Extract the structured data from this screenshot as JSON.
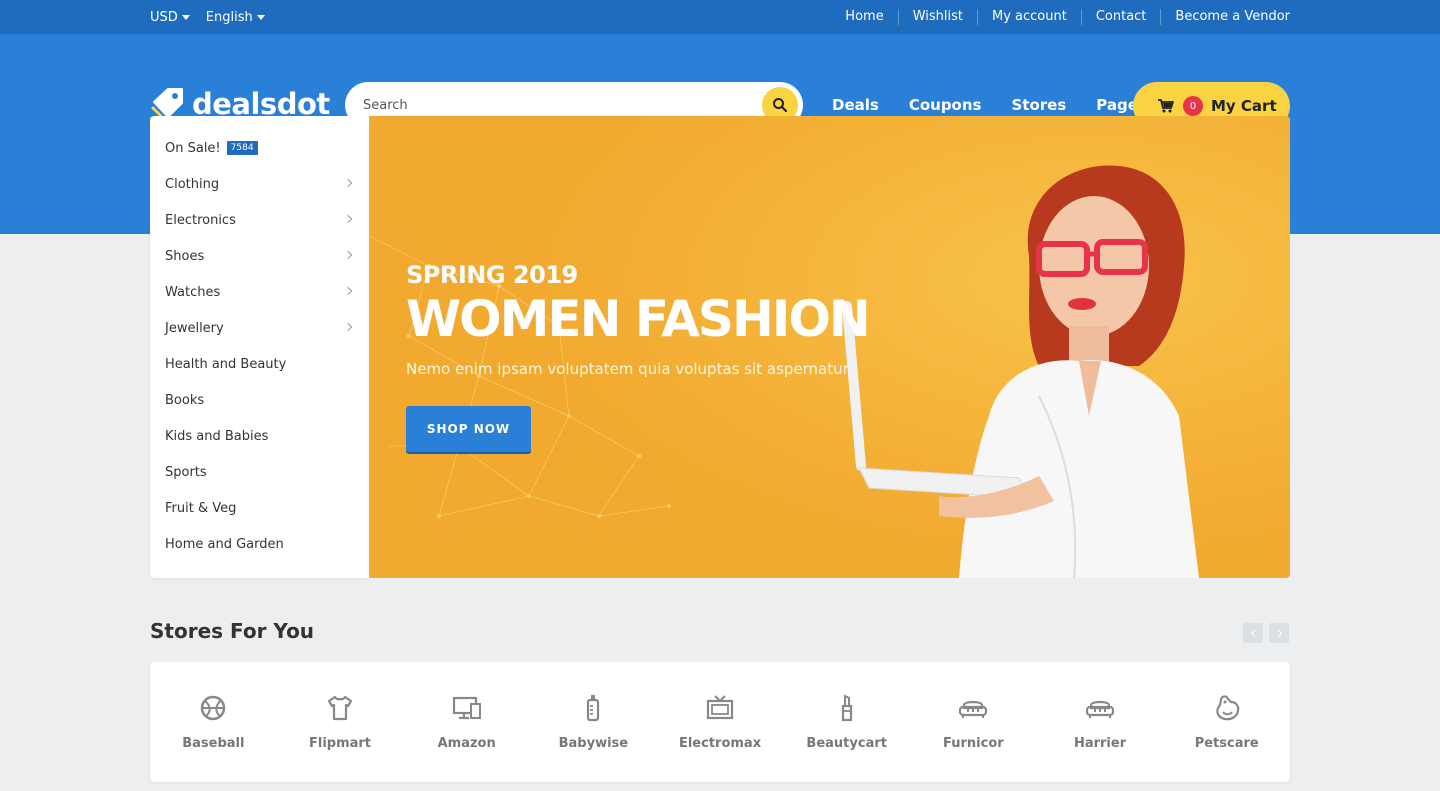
{
  "topbar": {
    "currency": "USD",
    "language": "English",
    "links": [
      "Home",
      "Wishlist",
      "My account",
      "Contact",
      "Become a Vendor"
    ]
  },
  "header": {
    "logo_text": "dealsdot",
    "search_placeholder": "Search",
    "nav": [
      "Deals",
      "Coupons",
      "Stores",
      "Pages"
    ],
    "cart_count": "0",
    "cart_label": "My Cart"
  },
  "categories": [
    {
      "label": "On Sale!",
      "count": "7584"
    },
    {
      "label": "Clothing"
    },
    {
      "label": "Electronics"
    },
    {
      "label": "Shoes"
    },
    {
      "label": "Watches"
    },
    {
      "label": "Jewellery"
    },
    {
      "label": "Health and Beauty"
    },
    {
      "label": "Books"
    },
    {
      "label": "Kids and Babies"
    },
    {
      "label": "Sports"
    },
    {
      "label": "Fruit & Veg"
    },
    {
      "label": "Home and Garden"
    }
  ],
  "hero": {
    "kicker": "SPRING 2019",
    "title": "WOMEN FASHION",
    "subtitle": "Nemo enim ipsam voluptatem quia voluptas sit aspernatur.",
    "button": "SHOP NOW"
  },
  "stores": {
    "title": "Stores For You",
    "items": [
      {
        "name": "Baseball",
        "icon": "basketball-icon"
      },
      {
        "name": "Flipmart",
        "icon": "tshirt-icon"
      },
      {
        "name": "Amazon",
        "icon": "computer-icon"
      },
      {
        "name": "Babywise",
        "icon": "baby-bottle-icon"
      },
      {
        "name": "Electromax",
        "icon": "tv-icon"
      },
      {
        "name": "Beautycart",
        "icon": "lipstick-icon"
      },
      {
        "name": "Furnicor",
        "icon": "sofa-icon"
      },
      {
        "name": "Harrier",
        "icon": "sofa-icon"
      },
      {
        "name": "Petscare",
        "icon": "pet-icon"
      }
    ]
  },
  "colors": {
    "topbar": "#1f6bbd",
    "header": "#2a80d7",
    "accent_yellow": "#f9d342",
    "hero_bg": "#f5b739",
    "badge_red": "#e8344a"
  }
}
